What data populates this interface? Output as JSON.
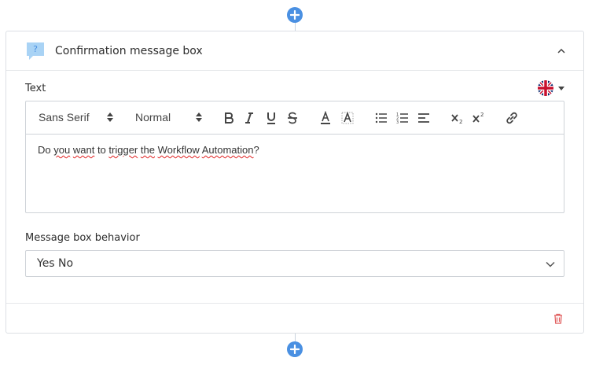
{
  "card": {
    "title": "Confirmation message box"
  },
  "text_section": {
    "label": "Text",
    "language_flag": "uk-flag-icon"
  },
  "toolbar": {
    "font_family": "Sans Serif",
    "font_size": "Normal",
    "buttons": [
      "bold-icon",
      "italic-icon",
      "underline-icon",
      "strikethrough-icon",
      "font-color-icon",
      "background-color-icon",
      "bullet-list-icon",
      "numbered-list-icon",
      "align-icon",
      "subscript-icon",
      "superscript-icon",
      "link-icon"
    ]
  },
  "editor": {
    "content": "Do you want to trigger the Workflow Automation?"
  },
  "behavior": {
    "label": "Message box behavior",
    "value": "Yes No"
  },
  "colors": {
    "accent": "#4a90e2",
    "delete": "#e05a5a",
    "border": "#dcdfe4"
  }
}
